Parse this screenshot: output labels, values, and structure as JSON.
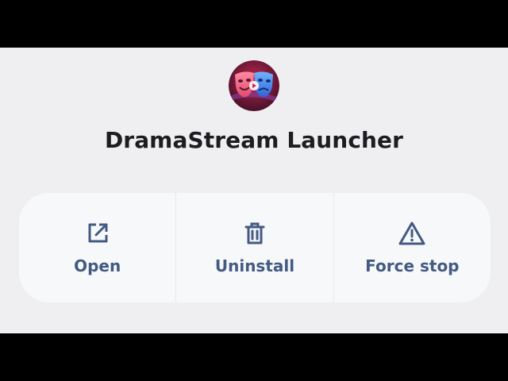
{
  "app": {
    "name": "DramaStream Launcher",
    "icon": "theater-masks-icon"
  },
  "actions": [
    {
      "label": "Open",
      "icon": "open-external-icon"
    },
    {
      "label": "Uninstall",
      "icon": "trash-icon"
    },
    {
      "label": "Force stop",
      "icon": "warning-triangle-icon"
    }
  ],
  "colors": {
    "background": "#efeff1",
    "card": "#f7f8fa",
    "action_text": "#435a83",
    "title_text": "#1d1d21"
  }
}
